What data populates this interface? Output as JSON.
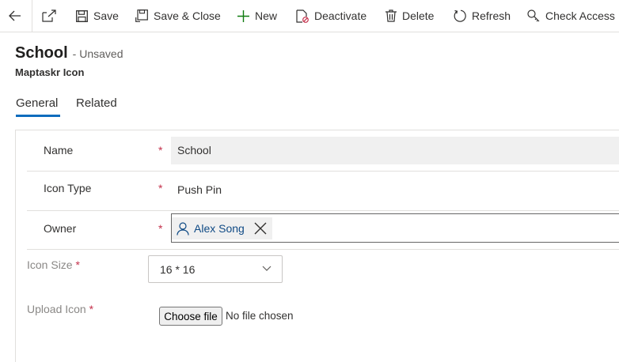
{
  "toolbar": {
    "save": "Save",
    "save_close": "Save & Close",
    "new": "New",
    "deactivate": "Deactivate",
    "delete": "Delete",
    "refresh": "Refresh",
    "check_access": "Check Access"
  },
  "header": {
    "title": "School",
    "status": "- Unsaved",
    "entity": "Maptaskr Icon"
  },
  "tabs": [
    {
      "label": "General",
      "selected": true
    },
    {
      "label": "Related",
      "selected": false
    }
  ],
  "form": {
    "name": {
      "label": "Name",
      "required": "*",
      "value": "School"
    },
    "icon_type": {
      "label": "Icon Type",
      "required": "*",
      "value": "Push Pin"
    },
    "owner": {
      "label": "Owner",
      "required": "*",
      "value": "Alex Song"
    },
    "icon_size": {
      "label": "Icon Size",
      "required": "*",
      "value": "16 * 16"
    },
    "upload_icon": {
      "label": "Upload Icon",
      "required": "*",
      "button": "Choose file",
      "status": "No file chosen"
    }
  },
  "colors": {
    "accent": "#0f6cbd",
    "required": "#c4314b",
    "lookup_text": "#0f4a85"
  }
}
